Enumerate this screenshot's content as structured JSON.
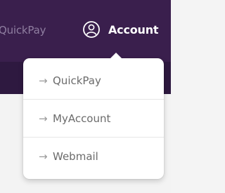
{
  "nav": {
    "quickpay_label": "QuickPay",
    "account_label": "Account",
    "account_icon": "user-circle-icon"
  },
  "dropdown": {
    "items": [
      {
        "arrow": "→",
        "label": "QuickPay"
      },
      {
        "arrow": "→",
        "label": "MyAccount"
      },
      {
        "arrow": "→",
        "label": "Webmail"
      }
    ]
  },
  "colors": {
    "header_bg": "#3a1f4d",
    "subheader_bg": "#2e1940",
    "page_bg": "#f3f3f3",
    "menu_text": "#6b6b6b",
    "nav_muted_text": "#8f7ea0",
    "nav_text": "#ffffff"
  }
}
